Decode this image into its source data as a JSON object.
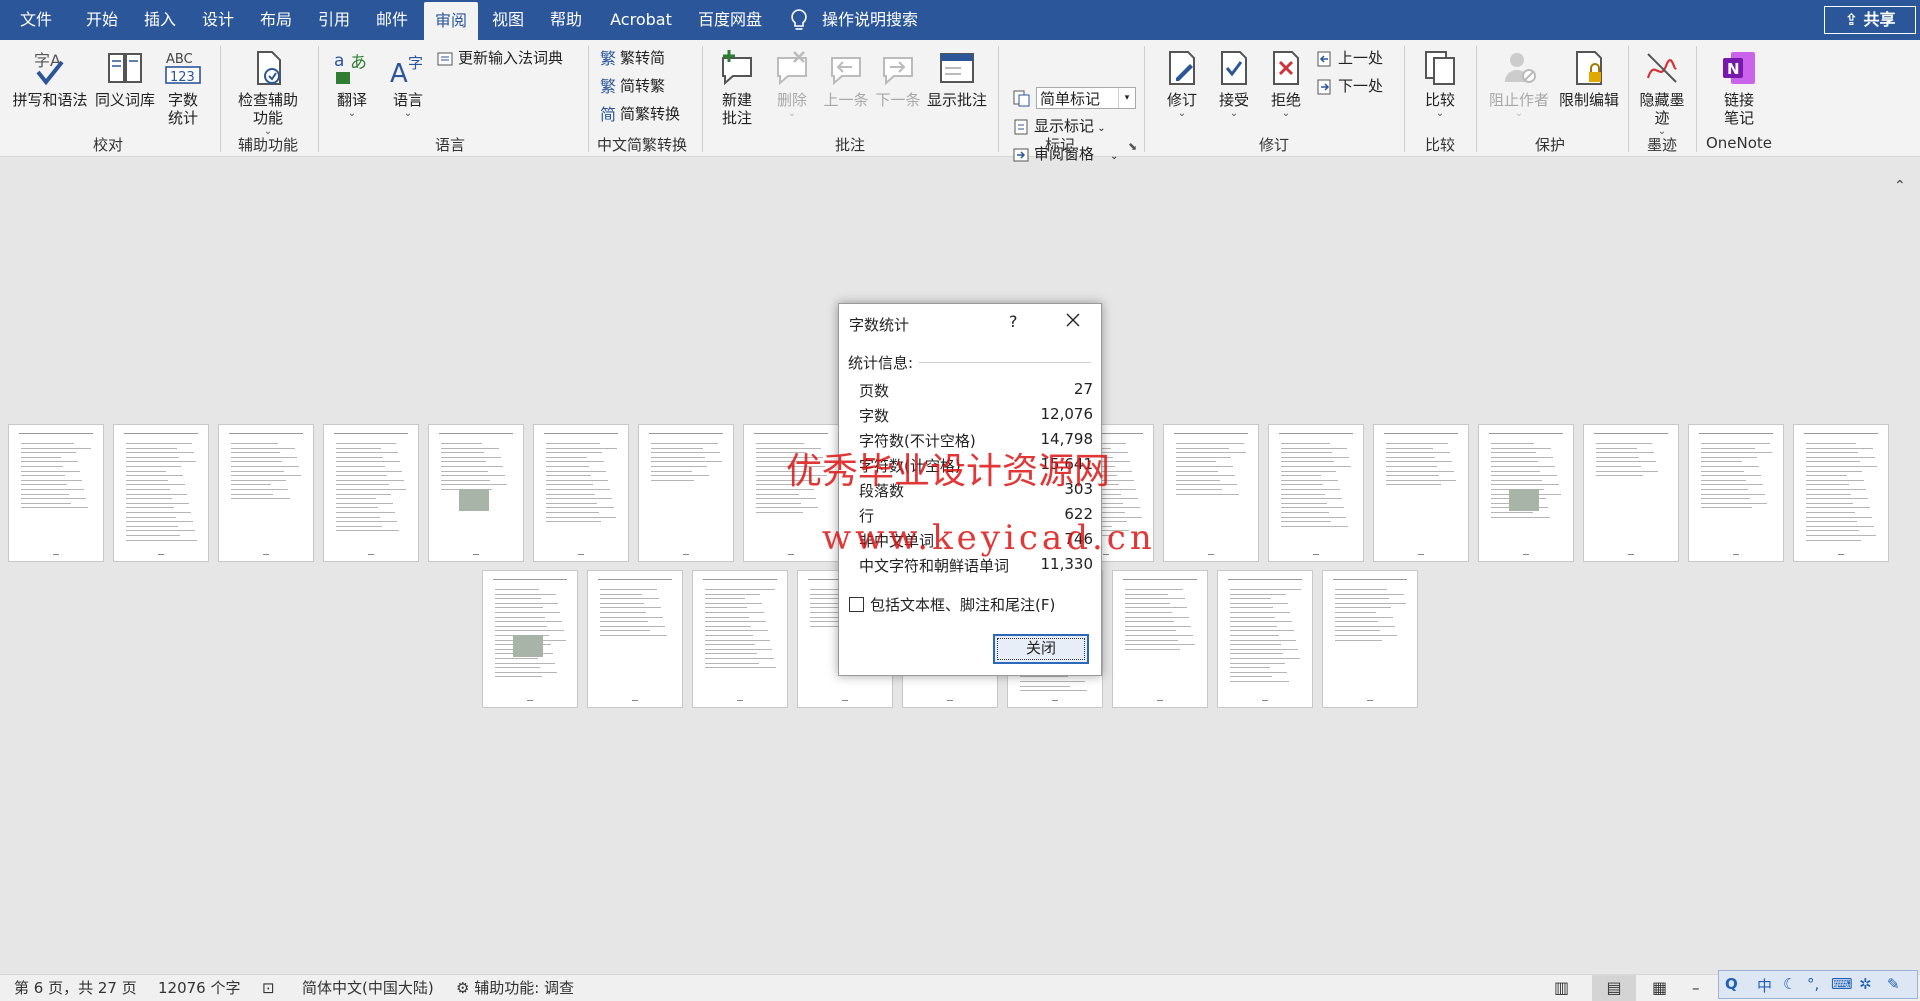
{
  "menu": {
    "tabs": [
      "文件",
      "开始",
      "插入",
      "设计",
      "布局",
      "引用",
      "邮件",
      "审阅",
      "视图",
      "帮助",
      "Acrobat",
      "百度网盘"
    ],
    "active_tab": "审阅",
    "search_label": "操作说明搜索",
    "share_label": "共享"
  },
  "ribbon": {
    "proofing": {
      "spelling": "拼写和语法",
      "thesaurus": "同义词库",
      "wordcount": "字数统计",
      "group": "校对"
    },
    "accessibility": {
      "check": "检查辅助功能",
      "group": "辅助功能"
    },
    "language": {
      "translate": "翻译",
      "language": "语言",
      "update_ime": "更新输入法词典",
      "group": "语言"
    },
    "chinese": {
      "to_trad": "繁转简",
      "to_simp": "简转繁",
      "convert": "简繁转换",
      "group": "中文简繁转换"
    },
    "comments": {
      "new": "新建批注",
      "delete": "删除",
      "prev": "上一条",
      "next": "下一条",
      "show": "显示批注",
      "group": "批注"
    },
    "tracking": {
      "markup_value": "简单标记",
      "show_markup": "显示标记",
      "pane": "审阅窗格",
      "group": "标记"
    },
    "changes": {
      "track": "修订",
      "accept": "接受",
      "reject": "拒绝",
      "prev": "上一处",
      "next": "下一处",
      "group": "修订"
    },
    "compare": {
      "compare": "比较",
      "group": "比较"
    },
    "protect": {
      "block": "阻止作者",
      "restrict": "限制编辑",
      "group": "保护"
    },
    "ink": {
      "hide": "隐藏墨迹",
      "group": "墨迹"
    },
    "onenote": {
      "link": "链接笔记",
      "group": "OneNote"
    }
  },
  "dialog": {
    "title": "字数统计",
    "help": "?",
    "section": "统计信息:",
    "rows": [
      {
        "label": "页数",
        "value": "27"
      },
      {
        "label": "字数",
        "value": "12,076"
      },
      {
        "label": "字符数(不计空格)",
        "value": "14,798"
      },
      {
        "label": "字符数(计空格)",
        "value": "15,641"
      },
      {
        "label": "段落数",
        "value": "303"
      },
      {
        "label": "行",
        "value": "622"
      },
      {
        "label": "非中文单词",
        "value": "746"
      },
      {
        "label": "中文字符和朝鲜语单词",
        "value": "11,330"
      }
    ],
    "checkbox_label": "包括文本框、脚注和尾注(F)",
    "close_label": "关闭"
  },
  "watermark": {
    "line1": "优秀毕业设计资源网",
    "line2": "www.keyicad.cn"
  },
  "statusbar": {
    "page": "第 6 页，共 27 页",
    "words": "12076 个字",
    "language": "简体中文(中国大陆)",
    "accessibility": "辅助功能: 调查"
  },
  "colors": {
    "brand": "#2b579a",
    "watermark": "#dc1414"
  }
}
